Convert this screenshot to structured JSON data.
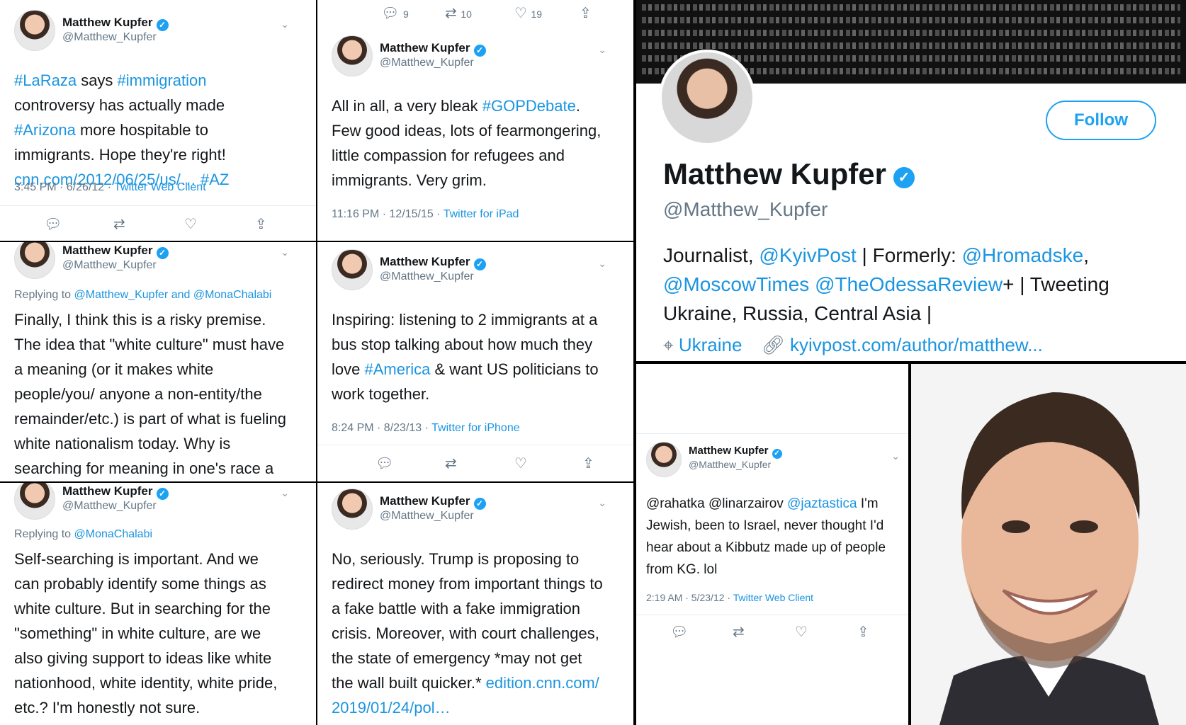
{
  "p1": {
    "name": "Matthew Kupfer",
    "handle": "@Matthew_Kupfer",
    "text_parts": [
      "#LaRaza",
      " says ",
      "#immigration",
      " controversy has actually made ",
      "#Arizona",
      " more hospitable to immigrants. Hope they're right! ",
      "cnn.com/2012/06/25/us/…",
      " ",
      "#AZ"
    ],
    "time": "3:45 PM · 6/26/12 · ",
    "client": "Twitter Web Client"
  },
  "p2": {
    "counts": {
      "replies": "9",
      "retweets": "10",
      "likes": "19"
    },
    "name": "Matthew Kupfer",
    "handle": "@Matthew_Kupfer",
    "text_parts": [
      "All in all, a very bleak ",
      "#GOPDebate",
      ". Few good ideas, lots of fearmongering, little compassion for refugees and immigrants. Very grim."
    ],
    "time": "11:16 PM · 12/15/15 · ",
    "client": "Twitter for iPad"
  },
  "p3": {
    "name": "Matthew Kupfer",
    "handle": "@Matthew_Kupfer",
    "reply_prefix": "Replying to ",
    "reply_to": "@Matthew_Kupfer and @MonaChalabi",
    "text": "Finally, I think this is a risky premise. The idea that \"white culture\" must have a meaning (or it makes white people/you/ anyone a non-entity/the remainder/etc.) is part of what is fueling white nationalism today. Why is searching for meaning in one's race a requirement?"
  },
  "p4": {
    "name": "Matthew Kupfer",
    "handle": "@Matthew_Kupfer",
    "text_parts": [
      "Inspiring: listening to 2 immigrants at a bus stop talking about how much they love ",
      "#America",
      " & want US politicians to work together."
    ],
    "time": "8:24 PM · 8/23/13 · ",
    "client": "Twitter for iPhone"
  },
  "p5": {
    "name": "Matthew Kupfer",
    "handle": "@Matthew_Kupfer",
    "reply_prefix": "Replying to ",
    "reply_to": "@MonaChalabi",
    "text": "Self-searching is important. And we can probably identify some things as white culture. But in searching for the \"something\" in white culture, are we also giving support to ideas like white nationhood, white identity, white pride, etc.? I'm honestly not sure."
  },
  "p6": {
    "name": "Matthew Kupfer",
    "handle": "@Matthew_Kupfer",
    "text_parts": [
      "No, seriously. Trump is proposing to redirect money from important things to a fake battle with a fake immigration crisis. Moreover, with court challenges, the state of emergency *may not get the wall built quicker.* ",
      "edition.cnn.com/ 2019/01/24/pol…"
    ]
  },
  "profile": {
    "follow": "Follow",
    "name": "Matthew Kupfer",
    "handle": "@Matthew_Kupfer",
    "bio_parts": [
      "Journalist, ",
      "@KyivPost",
      " | Formerly: ",
      "@Hromadske",
      ", ",
      "@MoscowTimes",
      " ",
      "@TheOdessaReview",
      "+ | Tweeting Ukraine, Russia, Central Asia |"
    ],
    "location": "Ukraine",
    "url": "kyivpost.com/author/matthew..."
  },
  "p7": {
    "name": "Matthew Kupfer",
    "handle": "@Matthew_Kupfer",
    "text_parts": [
      "@rahatka @linarzairov ",
      "@jaztastica",
      " I'm Jewish, been to Israel, never thought I'd hear about a Kibbutz made up of people from KG. lol"
    ],
    "time": "2:19 AM · 5/23/12 · ",
    "client": "Twitter Web Client"
  },
  "colors": {
    "link": "#1b95e0",
    "verified": "#1da1f2",
    "muted": "#657786"
  }
}
